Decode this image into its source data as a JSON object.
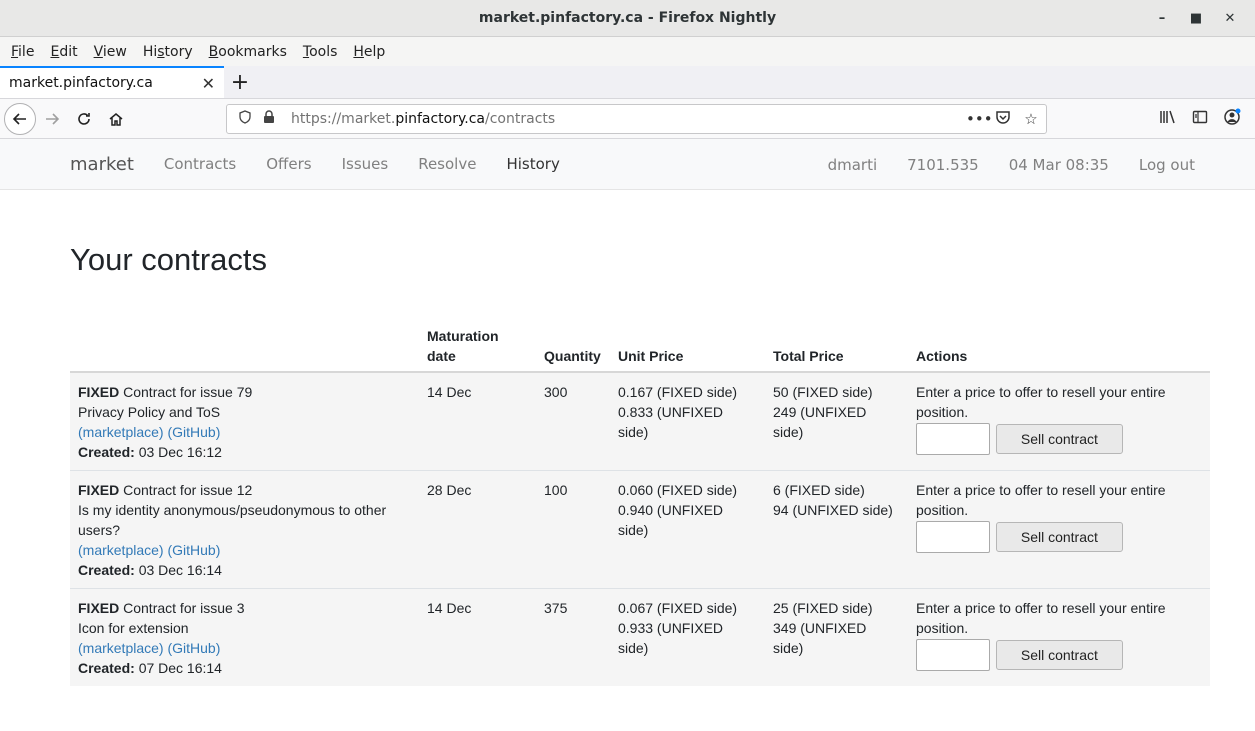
{
  "window": {
    "title": "market.pinfactory.ca - Firefox Nightly",
    "controls": [
      "–",
      "■",
      "✕"
    ]
  },
  "menu": [
    {
      "label": "File"
    },
    {
      "label": "Edit"
    },
    {
      "label": "View"
    },
    {
      "label": "History"
    },
    {
      "label": "Bookmarks"
    },
    {
      "label": "Tools"
    },
    {
      "label": "Help"
    }
  ],
  "tab": {
    "title": "market.pinfactory.ca",
    "close": "✕",
    "new": "+"
  },
  "url": {
    "prefix": "https://market.",
    "host": "pinfactory.ca",
    "path": "/contracts"
  },
  "site": {
    "brand": "market",
    "nav": [
      "Contracts",
      "Offers",
      "Issues",
      "Resolve",
      "History"
    ],
    "user": "dmarti",
    "balance": "7101.535",
    "datetime": "04 Mar 08:35",
    "logout": "Log out"
  },
  "page": {
    "title": "Your contracts",
    "headers": {
      "maturation": "Maturation date",
      "quantity": "Quantity",
      "unit_price": "Unit Price",
      "total_price": "Total Price",
      "actions": "Actions"
    },
    "contracts": [
      {
        "side": "FIXED",
        "label": "Contract for issue 79",
        "issue_title": "Privacy Policy and ToS",
        "link_marketplace": "(marketplace)",
        "link_github": "(GitHub)",
        "created_label": "Created:",
        "created": "03 Dec 16:12",
        "maturation": "14 Dec",
        "quantity": "300",
        "unit_fixed": "0.167 (FIXED side)",
        "unit_unfixed": "0.833 (UNFIXED side)",
        "total_fixed": "50 (FIXED side)",
        "total_unfixed": "249 (UNFIXED side)",
        "action_text": "Enter a price to offer to resell your entire position.",
        "button": "Sell contract"
      },
      {
        "side": "FIXED",
        "label": "Contract for issue 12",
        "issue_title": "Is my identity anonymous/pseudonymous to other users?",
        "link_marketplace": "(marketplace)",
        "link_github": "(GitHub)",
        "created_label": "Created:",
        "created": "03 Dec 16:14",
        "maturation": "28 Dec",
        "quantity": "100",
        "unit_fixed": "0.060 (FIXED side)",
        "unit_unfixed": "0.940 (UNFIXED side)",
        "total_fixed": "6 (FIXED side)",
        "total_unfixed": "94 (UNFIXED side)",
        "action_text": "Enter a price to offer to resell your entire position.",
        "button": "Sell contract"
      },
      {
        "side": "FIXED",
        "label": "Contract for issue 3",
        "issue_title": "Icon for extension",
        "link_marketplace": "(marketplace)",
        "link_github": "(GitHub)",
        "created_label": "Created:",
        "created": "07 Dec 16:14",
        "maturation": "14 Dec",
        "quantity": "375",
        "unit_fixed": "0.067 (FIXED side)",
        "unit_unfixed": "0.933 (UNFIXED side)",
        "total_fixed": "25 (FIXED side)",
        "total_unfixed": "349 (UNFIXED side)",
        "action_text": "Enter a price to offer to resell your entire position.",
        "button": "Sell contract"
      }
    ]
  },
  "icons": {
    "back": "back-arrow-icon",
    "forward": "forward-arrow-icon",
    "reload": "reload-icon",
    "home": "home-icon",
    "shield": "shield-icon",
    "lock": "lock-icon",
    "more": "more-icon",
    "pocket": "pocket-icon",
    "star": "star-icon",
    "library": "library-icon",
    "sidebar": "sidebar-icon",
    "account": "account-icon"
  },
  "colors": {
    "accent": "#0a84ff",
    "link": "#337ab7"
  }
}
